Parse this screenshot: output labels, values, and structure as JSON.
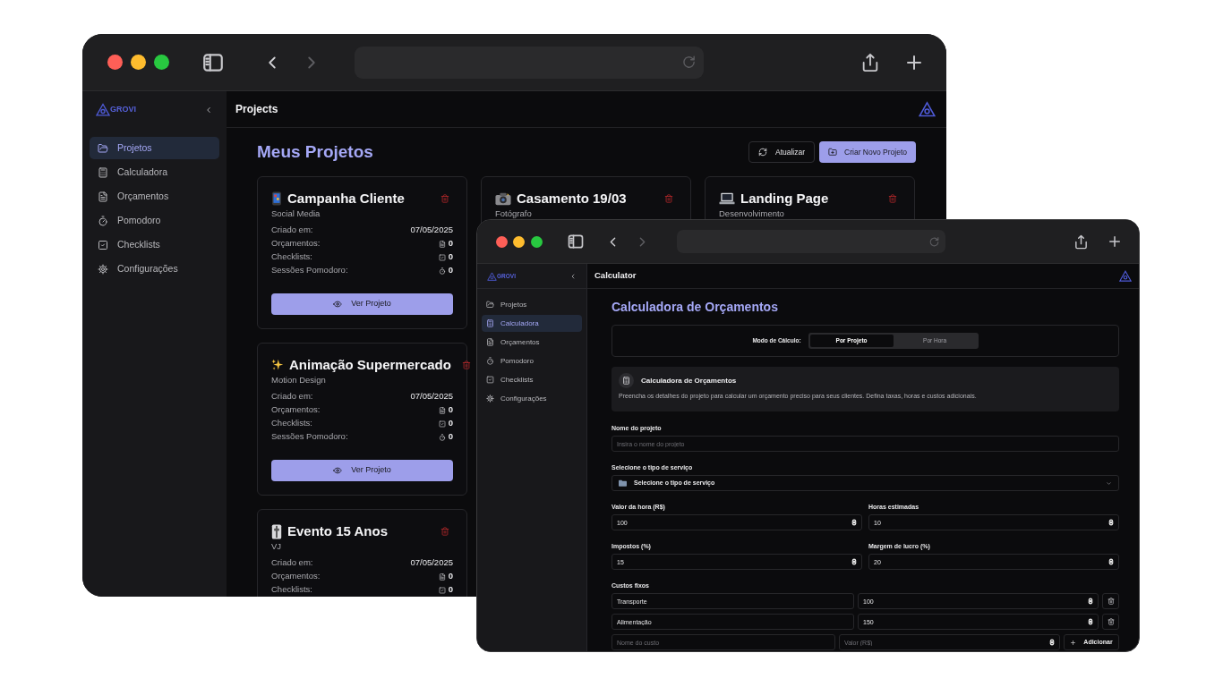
{
  "back_window": {
    "sidebar": {
      "logo": "GROVI",
      "nav": [
        {
          "label": "Projetos",
          "selected": true
        },
        {
          "label": "Calculadora",
          "selected": false
        },
        {
          "label": "Orçamentos",
          "selected": false
        },
        {
          "label": "Pomodoro",
          "selected": false
        },
        {
          "label": "Checklists",
          "selected": false
        },
        {
          "label": "Configurações",
          "selected": false
        }
      ]
    },
    "header_title": "Projects",
    "page_title": "Meus Projetos",
    "actions": [
      {
        "label": "Atualizar",
        "kind": "secondary"
      },
      {
        "label": "Criar Novo Projeto",
        "kind": "primary"
      }
    ],
    "project_rows": [
      [
        {
          "title": "Campanha Cliente",
          "category": "Social Media",
          "stats": [
            {
              "kind": "date",
              "label": "Criado em:",
              "value": "07/05/2025"
            },
            {
              "kind": "budgets",
              "label": "Orçamentos:",
              "value": "0"
            },
            {
              "kind": "checklists",
              "label": "Checklists:",
              "value": "0"
            },
            {
              "kind": "pomodoro",
              "label": "Sessões Pomodoro:",
              "value": "0"
            }
          ],
          "button": "Ver Projeto"
        },
        {
          "title": "Casamento 19/03",
          "category": "Fotógrafo"
        },
        {
          "title": "Landing Page",
          "category": "Desenvolvimento"
        }
      ],
      [
        {
          "title": "Animação Supermercado",
          "category": "Motion Design",
          "stats": [
            {
              "kind": "date",
              "label": "Criado em:",
              "value": "07/05/2025"
            },
            {
              "kind": "budgets",
              "label": "Orçamentos:",
              "value": "0"
            },
            {
              "kind": "checklists",
              "label": "Checklists:",
              "value": "0"
            },
            {
              "kind": "pomodoro",
              "label": "Sessões Pomodoro:",
              "value": "0"
            }
          ],
          "button": "Ver Projeto"
        }
      ],
      [
        {
          "title": "Evento 15 Anos",
          "category": "VJ",
          "stats": [
            {
              "kind": "date",
              "label": "Criado em:",
              "value": "07/05/2025"
            },
            {
              "kind": "budgets",
              "label": "Orçamentos:",
              "value": "0"
            },
            {
              "kind": "checklists",
              "label": "Checklists:",
              "value": "0"
            }
          ]
        }
      ]
    ]
  },
  "front_window": {
    "sidebar": {
      "logo": "GROVI",
      "nav": [
        {
          "label": "Projetos",
          "selected": false
        },
        {
          "label": "Calculadora",
          "selected": true
        },
        {
          "label": "Orçamentos",
          "selected": false
        },
        {
          "label": "Pomodoro",
          "selected": false
        },
        {
          "label": "Checklists",
          "selected": false
        },
        {
          "label": "Configurações",
          "selected": false
        }
      ]
    },
    "header_title": "Calculator",
    "page_title": "Calculadora de Orçamentos",
    "mode": {
      "label": "Modo de Cálculo:",
      "options": [
        {
          "label": "Por Projeto",
          "selected": true
        },
        {
          "label": "Por Hora",
          "selected": false
        }
      ]
    },
    "info": {
      "title": "Calculadora de Orçamentos",
      "description": "Preencha os detalhes do projeto para calcular um orçamento preciso para seus clientes. Defina taxas, horas e custos adicionais."
    },
    "project_name": {
      "label": "Nome do projeto",
      "placeholder": "Insira o nome do projeto"
    },
    "service_type": {
      "label": "Selecione o tipo de serviço",
      "value": "Selecione o tipo de serviço"
    },
    "number_fields": [
      {
        "label": "Valor da hora (R$)",
        "value": "100"
      },
      {
        "label": "Horas estimadas",
        "value": "10"
      },
      {
        "label": "Impostos (%)",
        "value": "15"
      },
      {
        "label": "Margem de lucro (%)",
        "value": "20"
      }
    ],
    "fixed_costs": {
      "label": "Custos fixos",
      "items": [
        {
          "name": "Transporte",
          "value": "100"
        },
        {
          "name": "Alimentação",
          "value": "150"
        }
      ],
      "new_name_placeholder": "Nome do custo",
      "new_value_placeholder": "Valor (R$)",
      "add_button": "Adicionar"
    }
  }
}
